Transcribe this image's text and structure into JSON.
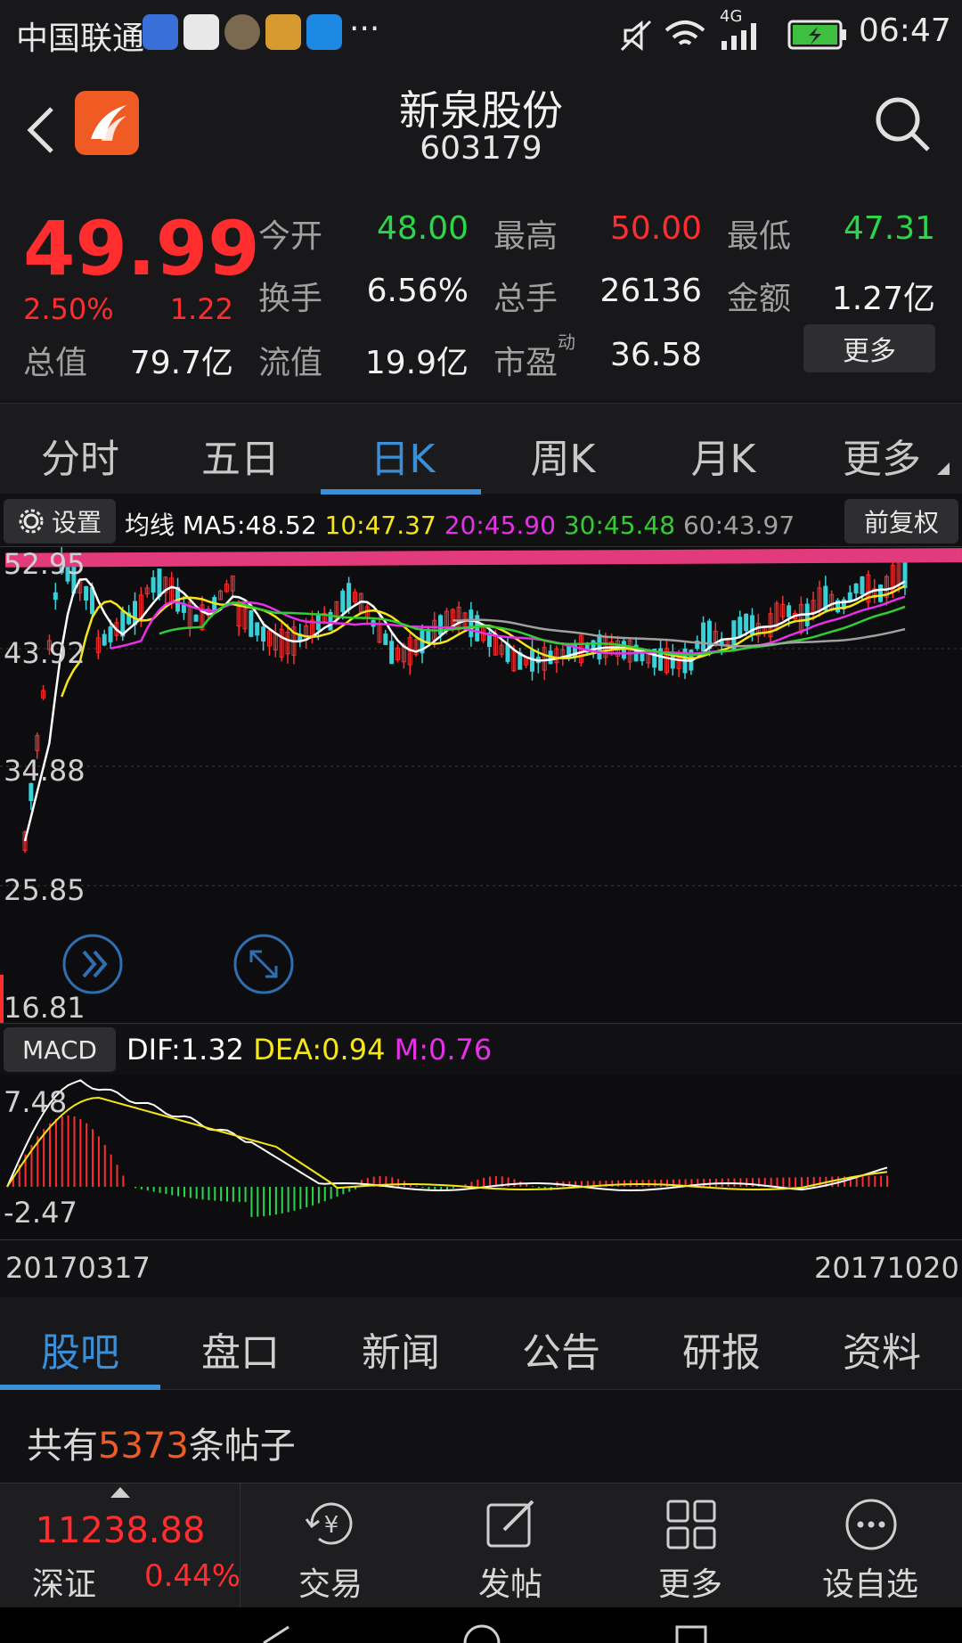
{
  "status_bar": {
    "carrier": "中国联通",
    "network": "4G",
    "time": "06:47",
    "more": "···"
  },
  "header": {
    "title": "新泉股份",
    "code": "603179"
  },
  "quote": {
    "price": "49.99",
    "change_pct": "2.50%",
    "change_amt": "1.22",
    "open_label": "今开",
    "open": "48.00",
    "high_label": "最高",
    "high": "50.00",
    "low_label": "最低",
    "low": "47.31",
    "turnover_label": "换手",
    "turnover": "6.56%",
    "volume_label": "总手",
    "volume": "26136",
    "amount_label": "金额",
    "amount": "1.27亿",
    "mktcap_label": "总值",
    "mktcap": "79.7亿",
    "float_label": "流值",
    "float": "19.9亿",
    "pe_label": "市盈",
    "pe_sup": "动",
    "pe": "36.58",
    "more_label": "更多"
  },
  "period_tabs": [
    "分时",
    "五日",
    "日K",
    "周K",
    "月K",
    "更多"
  ],
  "active_period": 2,
  "ma_bar": {
    "settings_label": "设置",
    "ma_title": "均线",
    "ma5": "MA5:48.52",
    "ma10": "10:47.37",
    "ma20": "20:45.90",
    "ma30": "30:45.48",
    "ma60": "60:43.97",
    "adjust_label": "前复权"
  },
  "kline_axis": [
    "52.95",
    "43.92",
    "34.88",
    "25.85",
    "16.81"
  ],
  "macd": {
    "label": "MACD",
    "dif": "DIF:1.32",
    "dea": "DEA:0.94",
    "m": "M:0.76",
    "axis_top": "7.48",
    "axis_bottom": "-2.47"
  },
  "dates": {
    "start": "20170317",
    "end": "20171020"
  },
  "bottom_tabs": [
    "股吧",
    "盘口",
    "新闻",
    "公告",
    "研报",
    "资料"
  ],
  "active_bottom_tab": 0,
  "post_count": {
    "prefix": "共有",
    "count": "5373",
    "suffix": "条帖子"
  },
  "footer": {
    "index_value": "11238.88",
    "index_name": "深证",
    "index_change": "0.44%",
    "buttons": [
      "交易",
      "发帖",
      "更多",
      "设自选"
    ]
  },
  "colors": {
    "up": "#ff2d2d",
    "down": "#2bd64a",
    "accent": "#3b8fd9",
    "ma5": "#ffffff",
    "ma10": "#f5e61a",
    "ma20": "#e830e8",
    "ma30": "#33cc33",
    "ma60": "#a0a0a0",
    "banner": "#e23a7a"
  }
}
